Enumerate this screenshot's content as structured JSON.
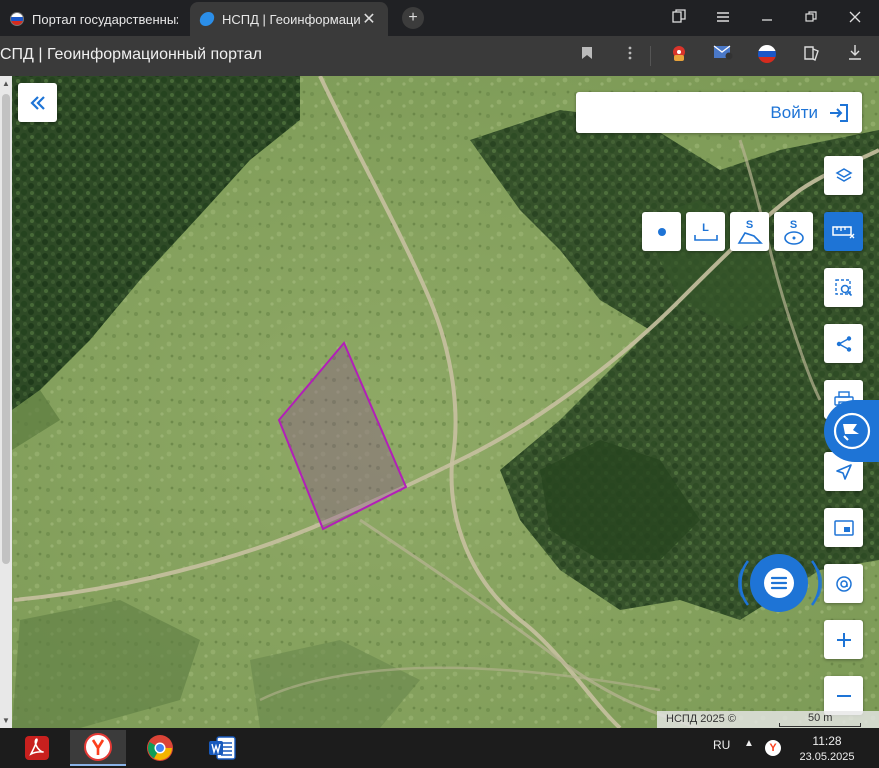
{
  "browser": {
    "tabs": [
      {
        "title": "Портал государственных",
        "active": false
      },
      {
        "title": "НСПД | Геоинформаци",
        "active": true
      }
    ],
    "close_glyph": "✕",
    "new_tab_glyph": "+",
    "address_title": "СПД | Геоинформационный портал"
  },
  "map": {
    "login_label": "Войти",
    "measure_tools": [
      "L",
      "S",
      "S"
    ],
    "attribution": "НСПД 2025 ©",
    "scale_label": "50 m",
    "plot_outline_color": "#b21fb8",
    "accent_color": "#1e74d6"
  },
  "taskbar": {
    "lang": "RU",
    "time": "11:28",
    "date": "23.05.2025"
  }
}
